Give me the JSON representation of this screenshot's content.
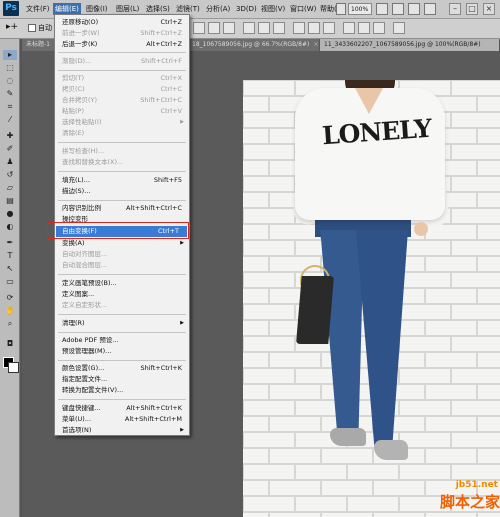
{
  "app": {
    "logo": "Ps"
  },
  "menubar": {
    "items": [
      {
        "label": "文件(F)"
      },
      {
        "label": "编辑(E)"
      },
      {
        "label": "图像(I)"
      },
      {
        "label": "图层(L)"
      },
      {
        "label": "选择(S)"
      },
      {
        "label": "滤镜(T)"
      },
      {
        "label": "分析(A)"
      },
      {
        "label": "3D(D)"
      },
      {
        "label": "视图(V)"
      },
      {
        "label": "窗口(W)"
      },
      {
        "label": "帮助(H)"
      }
    ],
    "zoom": "100%",
    "window_buttons": [
      "–",
      "□",
      "×"
    ]
  },
  "options_bar": {
    "auto_select": "自动"
  },
  "tabs": [
    {
      "label": "未标题-1",
      "close": "×"
    },
    {
      "label": "18_1067589056.jpg @ 66.7%(RGB/8#)",
      "close": "×"
    },
    {
      "label": "11_3433602207_1067589056.jpg @ 100%(RGB/8#)",
      "close": "×"
    }
  ],
  "edit_menu": {
    "items": [
      {
        "label": "还原移动(O)",
        "shortcut": "Ctrl+Z",
        "state": "enabled"
      },
      {
        "label": "前进一步(W)",
        "shortcut": "Shift+Ctrl+Z",
        "state": "disabled"
      },
      {
        "label": "后退一步(K)",
        "shortcut": "Alt+Ctrl+Z",
        "state": "enabled"
      },
      {
        "label": "渐隐(D)...",
        "shortcut": "Shift+Ctrl+F",
        "state": "disabled"
      },
      {
        "label": "剪切(T)",
        "shortcut": "Ctrl+X",
        "state": "disabled"
      },
      {
        "label": "拷贝(C)",
        "shortcut": "Ctrl+C",
        "state": "disabled"
      },
      {
        "label": "合并拷贝(Y)",
        "shortcut": "Shift+Ctrl+C",
        "state": "disabled"
      },
      {
        "label": "粘贴(P)",
        "shortcut": "Ctrl+V",
        "state": "disabled"
      },
      {
        "label": "选择性粘贴(I)",
        "shortcut": "",
        "state": "disabled",
        "submenu": true
      },
      {
        "label": "清除(E)",
        "shortcut": "",
        "state": "disabled"
      },
      {
        "label": "拼写检查(H)...",
        "shortcut": "",
        "state": "disabled"
      },
      {
        "label": "查找和替换文本(X)...",
        "shortcut": "",
        "state": "disabled"
      },
      {
        "label": "填充(L)...",
        "shortcut": "Shift+F5",
        "state": "enabled"
      },
      {
        "label": "描边(S)...",
        "shortcut": "",
        "state": "enabled"
      },
      {
        "label": "内容识别比例",
        "shortcut": "Alt+Shift+Ctrl+C",
        "state": "enabled"
      },
      {
        "label": "操控变形",
        "shortcut": "",
        "state": "enabled"
      },
      {
        "label": "自由变换(F)",
        "shortcut": "Ctrl+T",
        "state": "highlighted"
      },
      {
        "label": "变换(A)",
        "shortcut": "",
        "state": "enabled",
        "submenu": true
      },
      {
        "label": "自动对齐图层...",
        "shortcut": "",
        "state": "disabled"
      },
      {
        "label": "自动混合图层...",
        "shortcut": "",
        "state": "disabled"
      },
      {
        "label": "定义画笔预设(B)...",
        "shortcut": "",
        "state": "enabled"
      },
      {
        "label": "定义图案...",
        "shortcut": "",
        "state": "enabled"
      },
      {
        "label": "定义自定形状...",
        "shortcut": "",
        "state": "disabled"
      },
      {
        "label": "清理(R)",
        "shortcut": "",
        "state": "enabled",
        "submenu": true
      },
      {
        "label": "Adobe PDF 预设...",
        "shortcut": "",
        "state": "enabled"
      },
      {
        "label": "预设管理器(M)...",
        "shortcut": "",
        "state": "enabled"
      },
      {
        "label": "颜色设置(G)...",
        "shortcut": "Shift+Ctrl+K",
        "state": "enabled"
      },
      {
        "label": "指定配置文件...",
        "shortcut": "",
        "state": "enabled"
      },
      {
        "label": "转换为配置文件(V)...",
        "shortcut": "",
        "state": "enabled"
      },
      {
        "label": "键盘快捷键...",
        "shortcut": "Alt+Shift+Ctrl+K",
        "state": "enabled"
      },
      {
        "label": "菜单(U)...",
        "shortcut": "Alt+Shift+Ctrl+M",
        "state": "enabled"
      },
      {
        "label": "首选项(N)",
        "shortcut": "",
        "state": "enabled",
        "submenu": true
      }
    ]
  },
  "image": {
    "shirt_text": "LONELY"
  },
  "watermark": {
    "site": "jb51.net",
    "text": "脚本之家"
  },
  "colors": {
    "highlight": "#3a7bd5",
    "callout_border": "#e0261b",
    "menu_active": "#3a6fb0"
  }
}
